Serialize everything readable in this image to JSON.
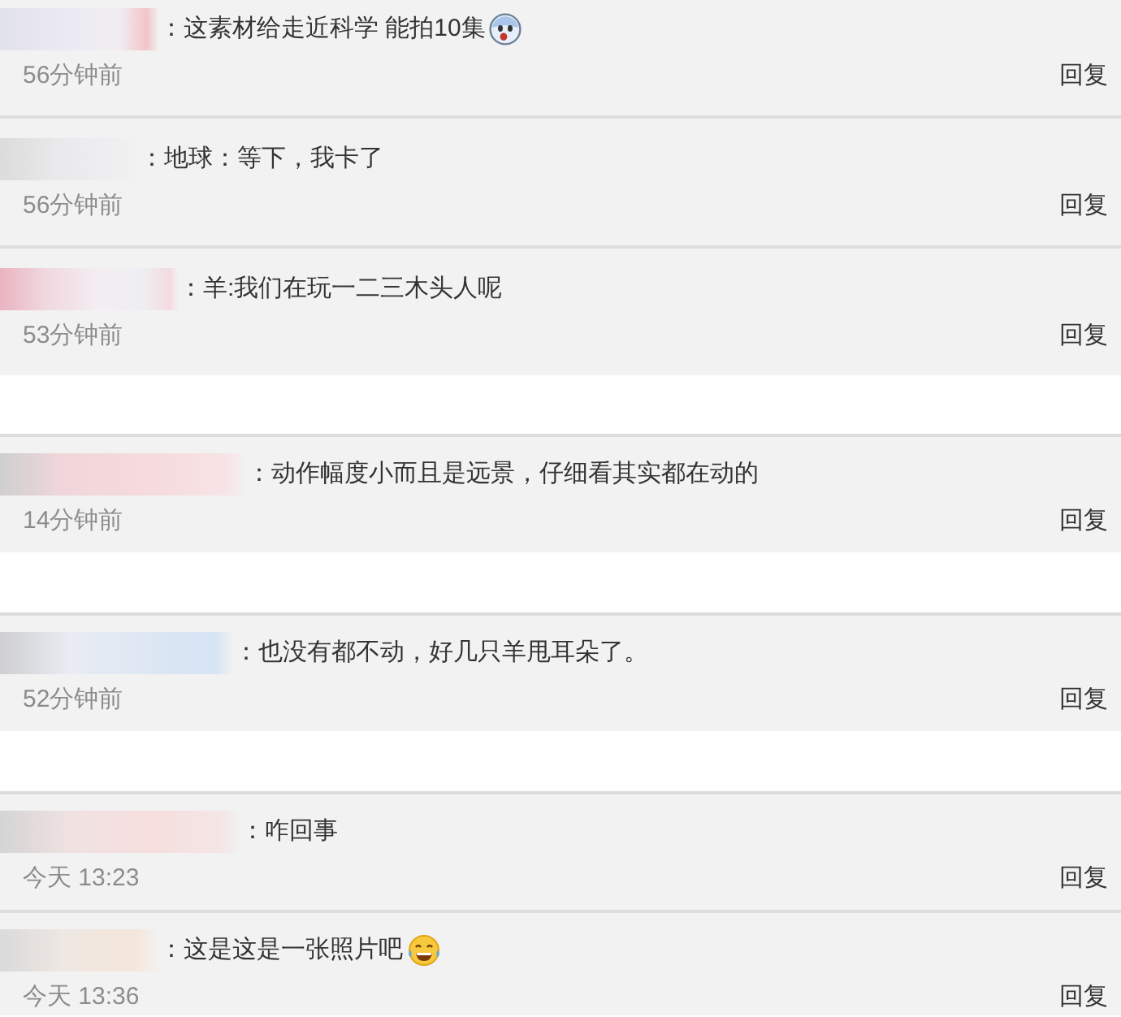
{
  "panels": [
    {
      "comments": [
        {
          "kind": "surprised",
          "text": "：这素材给走近科学 能拍10集",
          "time": "56分钟前",
          "reply": "回复"
        },
        {
          "kind": "plain",
          "text": "：地球：等下，我卡了",
          "time": "56分钟前",
          "reply": "回复"
        },
        {
          "kind": "plain",
          "text": "：羊:我们在玩一二三木头人呢",
          "time": "53分钟前",
          "reply": "回复"
        }
      ]
    },
    {
      "comments": [
        {
          "kind": "plain",
          "text": "：动作幅度小而且是远景，仔细看其实都在动的",
          "time": "14分钟前",
          "reply": "回复"
        }
      ]
    },
    {
      "comments": [
        {
          "kind": "plain",
          "text": "：也没有都不动，好几只羊甩耳朵了。",
          "time": "52分钟前",
          "reply": "回复"
        }
      ]
    },
    {
      "comments": [
        {
          "kind": "plain",
          "text": "：咋回事",
          "time": "今天 13:23",
          "reply": "回复"
        },
        {
          "kind": "laughing",
          "text": "：这是这是一张照片吧",
          "time": "今天 13:36",
          "reply": "回复"
        }
      ]
    }
  ]
}
